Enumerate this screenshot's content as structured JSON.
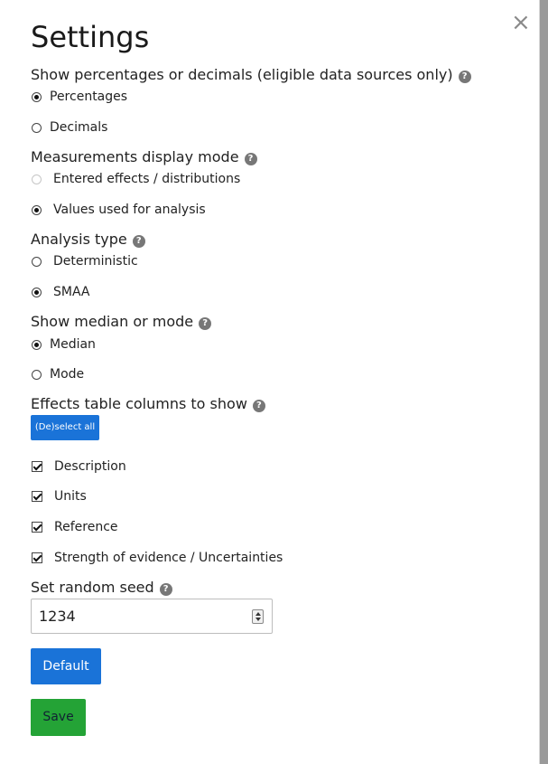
{
  "modal": {
    "title": "Settings",
    "close_glyph": "×",
    "help_glyph": "?"
  },
  "percentages": {
    "label": "Show percentages or decimals (eligible data sources only)",
    "options": [
      {
        "label": "Percentages",
        "checked": true
      },
      {
        "label": "Decimals",
        "checked": false
      }
    ]
  },
  "measurements": {
    "label": "Measurements display mode",
    "options": [
      {
        "label": "Entered effects / distributions",
        "checked": false,
        "disabled": true
      },
      {
        "label": "Values used for analysis",
        "checked": true
      }
    ]
  },
  "analysis": {
    "label": "Analysis type",
    "options": [
      {
        "label": "Deterministic",
        "checked": false
      },
      {
        "label": "SMAA",
        "checked": true
      }
    ]
  },
  "median_mode": {
    "label": "Show median or mode",
    "options": [
      {
        "label": "Median",
        "checked": true
      },
      {
        "label": "Mode",
        "checked": false
      }
    ]
  },
  "columns": {
    "label": "Effects table columns to show",
    "deselect_label": "(De)select all",
    "options": [
      {
        "label": "Description",
        "checked": true
      },
      {
        "label": "Units",
        "checked": true
      },
      {
        "label": "Reference",
        "checked": true
      },
      {
        "label": "Strength of evidence / Uncertainties",
        "checked": true
      }
    ]
  },
  "seed": {
    "label": "Set random seed",
    "value": "1234"
  },
  "buttons": {
    "default_label": "Default",
    "save_label": "Save"
  },
  "colors": {
    "primary": "#1a73d8",
    "success": "#24a336",
    "backdrop": "#8f8f8f"
  },
  "icons": [
    "close-icon",
    "help-icon",
    "spinner-up-icon",
    "spinner-down-icon"
  ]
}
